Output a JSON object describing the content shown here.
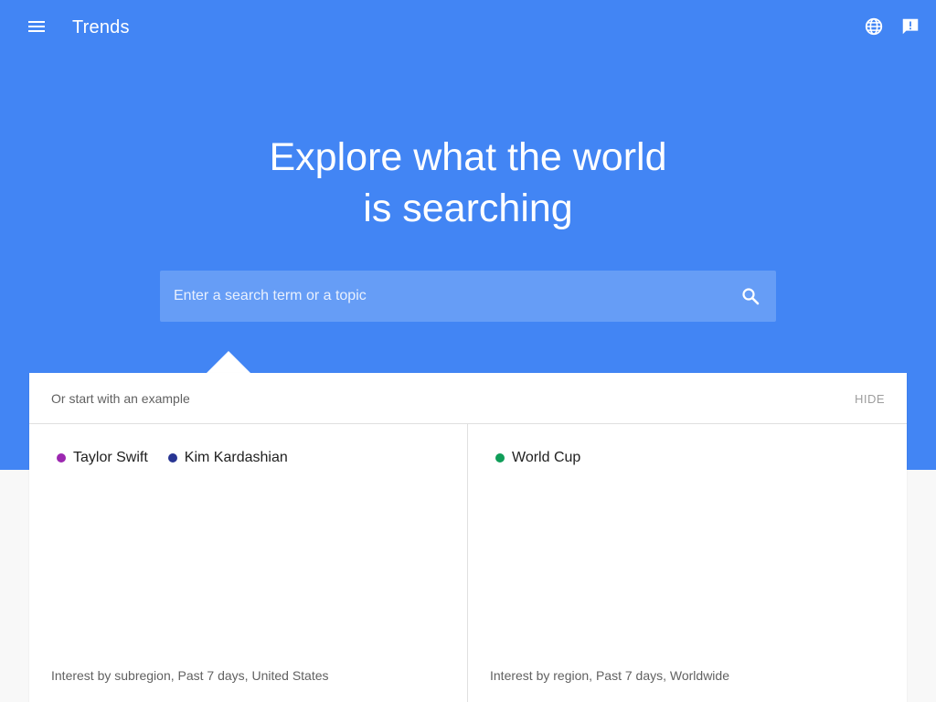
{
  "header": {
    "app_title": "Trends",
    "icons": {
      "menu": "menu-icon",
      "language": "globe-icon",
      "feedback": "feedback-icon"
    }
  },
  "hero": {
    "headline_line1": "Explore what the world",
    "headline_line2": "is searching"
  },
  "search": {
    "value": "",
    "placeholder": "Enter a search term or a topic",
    "icon": "search-icon"
  },
  "examples": {
    "title": "Or start with an example",
    "hide_label": "HIDE",
    "cards": [
      {
        "terms": [
          {
            "label": "Taylor Swift",
            "color": "#9c27b0"
          },
          {
            "label": "Kim Kardashian",
            "color": "#283593"
          }
        ],
        "caption": "Interest by subregion, Past 7 days, United States"
      },
      {
        "terms": [
          {
            "label": "World Cup",
            "color": "#0f9d58"
          }
        ],
        "caption": "Interest by region, Past 7 days, Worldwide"
      }
    ]
  },
  "colors": {
    "hero_background": "#4285f4",
    "search_background": "#669df6",
    "page_background": "#f8f8f8"
  }
}
